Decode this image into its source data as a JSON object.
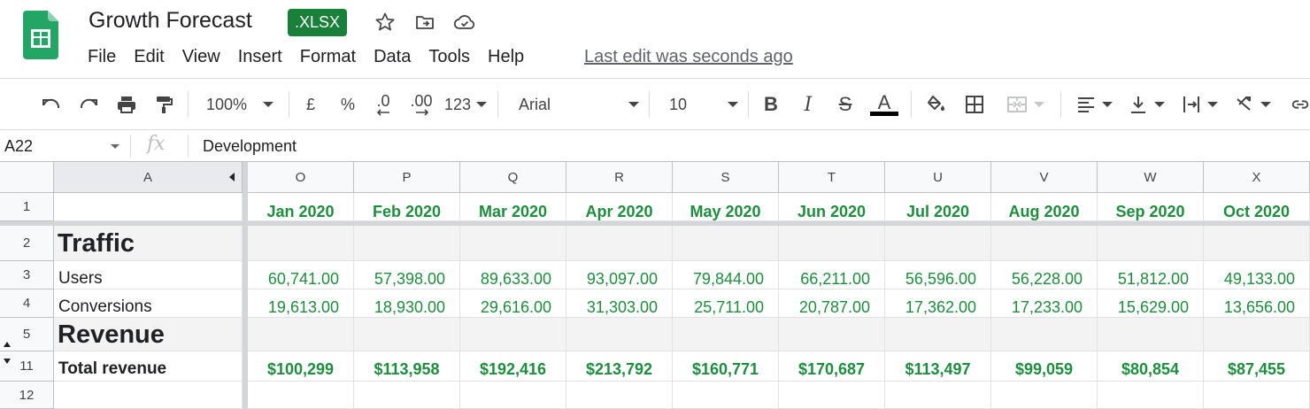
{
  "app": {
    "title": "Growth Forecast",
    "file_badge": ".XLSX",
    "last_edit": "Last edit was seconds ago",
    "brand_color": "#188038",
    "data_color": "#1e8e3e"
  },
  "menu": [
    "File",
    "Edit",
    "View",
    "Insert",
    "Format",
    "Data",
    "Tools",
    "Help"
  ],
  "toolbar": {
    "zoom": "100%",
    "currency": "£",
    "percent": "%",
    "decimal_decrease": ".0",
    "decimal_increase": ".00",
    "number_format": "123",
    "font": "Arial",
    "font_size": "10",
    "bold": "B",
    "italic": "I",
    "strike": "S",
    "text_color": "A"
  },
  "formula_bar": {
    "cell_ref": "A22",
    "fx": "fx",
    "value": "Development"
  },
  "columns": {
    "frozen": "A",
    "letters": [
      "O",
      "P",
      "Q",
      "R",
      "S",
      "T",
      "U",
      "V",
      "W",
      "X"
    ]
  },
  "rows": {
    "numbers": [
      "1",
      "2",
      "3",
      "4",
      "5",
      "11",
      "12"
    ]
  },
  "sheet": {
    "months": [
      "Jan 2020",
      "Feb 2020",
      "Mar 2020",
      "Apr 2020",
      "May 2020",
      "Jun 2020",
      "Jul 2020",
      "Aug 2020",
      "Sep 2020",
      "Oct 2020"
    ],
    "traffic_label": "Traffic",
    "users_label": "Users",
    "users": [
      "60,741.00",
      "57,398.00",
      "89,633.00",
      "93,097.00",
      "79,844.00",
      "66,211.00",
      "56,596.00",
      "56,228.00",
      "51,812.00",
      "49,133.00"
    ],
    "conversions_label": "Conversions",
    "conversions": [
      "19,613.00",
      "18,930.00",
      "29,616.00",
      "31,303.00",
      "25,711.00",
      "20,787.00",
      "17,362.00",
      "17,233.00",
      "15,629.00",
      "13,656.00"
    ],
    "revenue_label": "Revenue",
    "total_revenue_label": "Total revenue",
    "total_revenue": [
      "$100,299",
      "$113,958",
      "$192,416",
      "$213,792",
      "$160,771",
      "$170,687",
      "$113,497",
      "$99,059",
      "$80,854",
      "$87,455"
    ]
  }
}
